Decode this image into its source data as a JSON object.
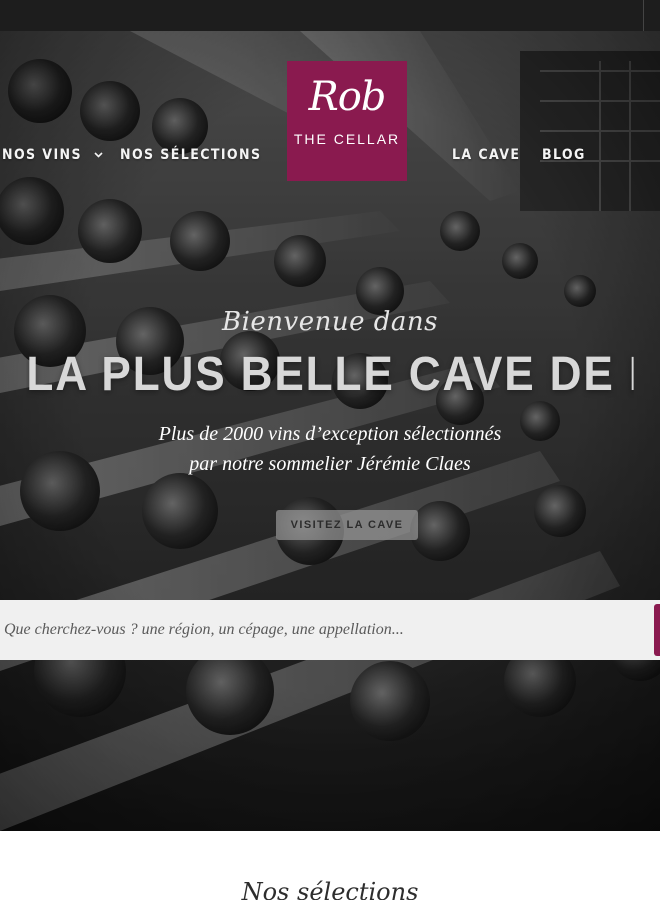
{
  "nav": {
    "items_left": [
      {
        "label": "NOS VINS",
        "has_dropdown": true
      },
      {
        "label": "NOS SÉLECTIONS",
        "has_dropdown": false
      }
    ],
    "items_right": [
      {
        "label": "LA CAVE"
      },
      {
        "label": "BLOG"
      }
    ],
    "dropdown_icon": "chevron-down-icon"
  },
  "logo": {
    "script": "Rob",
    "subtitle": "THE CELLAR",
    "color": "#8a1a4f"
  },
  "hero": {
    "pre_title": "Bienvenue dans",
    "title": "LA PLUS BELLE CAVE DE BELGIQUE",
    "subtitle_line1": "Plus de 2000 vins d’exception sélectionnés",
    "subtitle_line2": "par notre sommelier Jérémie Claes",
    "cta_label": "VISITEZ LA CAVE"
  },
  "search": {
    "placeholder": "Que cherchez-vous ? une région, un cépage, une appellation..."
  },
  "section": {
    "heading": "Nos sélections"
  },
  "colors": {
    "brand": "#8a1a4f",
    "topbar": "#1d1d1d",
    "search_bg": "#f0f0f0"
  }
}
